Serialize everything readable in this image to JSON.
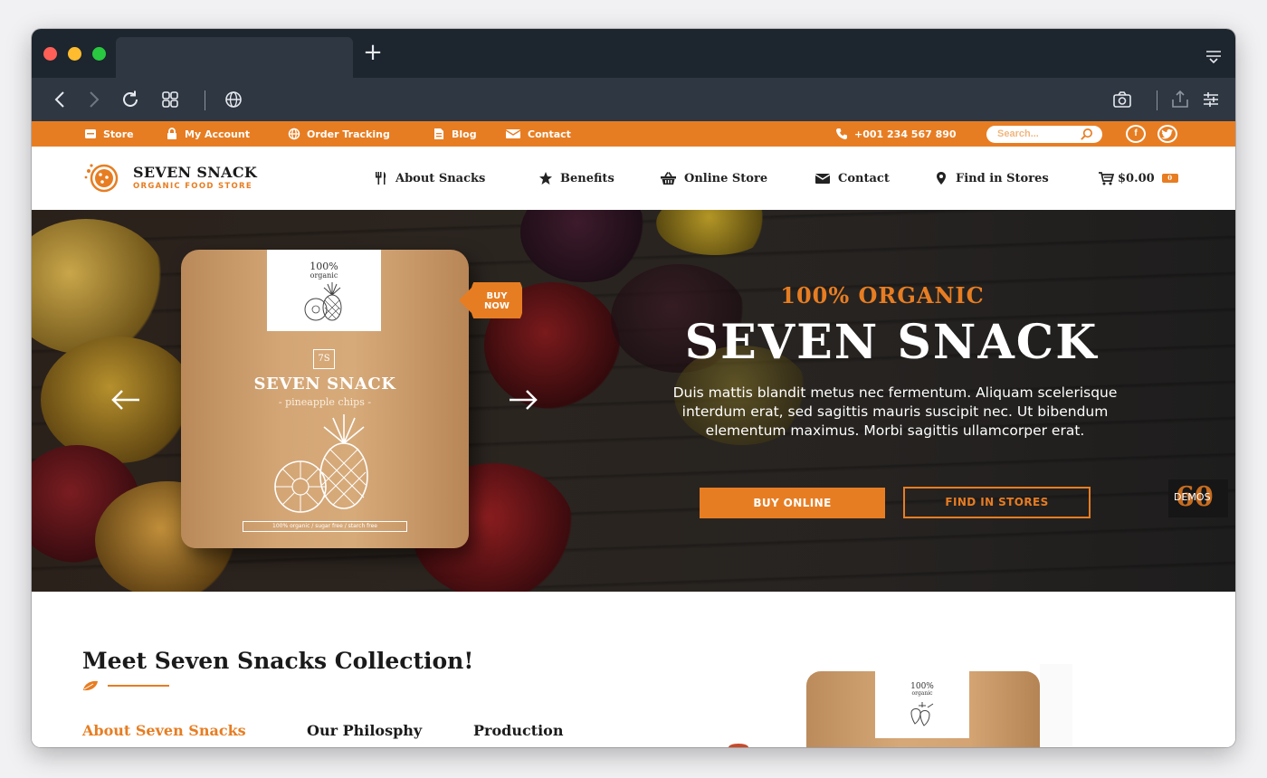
{
  "browser": {
    "new_tab_symbol": "+",
    "icons": [
      "back-icon",
      "forward-icon",
      "reload-icon",
      "tab-grid-icon",
      "globe-icon",
      "screenshot-icon",
      "share-icon",
      "settings-icon",
      "tab-menu-icon"
    ]
  },
  "topbar": {
    "links": [
      {
        "label": "Store",
        "icon": "store-icon"
      },
      {
        "label": "My Account",
        "icon": "lock-icon"
      },
      {
        "label": "Order Tracking",
        "icon": "globe-icon"
      },
      {
        "label": "Blog",
        "icon": "document-icon"
      },
      {
        "label": "Contact",
        "icon": "envelope-icon"
      }
    ],
    "phone": "+001 234 567 890",
    "search_placeholder": "Search...",
    "social": [
      "f",
      "t"
    ]
  },
  "header": {
    "brand": "SEVEN SNACK",
    "tagline": "ORGANIC FOOD STORE",
    "nav": [
      {
        "label": "About Snacks",
        "icon": "cutlery-icon"
      },
      {
        "label": "Benefits",
        "icon": "star-icon"
      },
      {
        "label": "Online Store",
        "icon": "basket-icon"
      },
      {
        "label": "Contact",
        "icon": "envelope-icon"
      },
      {
        "label": "Find in Stores",
        "icon": "map-pin-icon"
      }
    ],
    "cart_total": "$0.00",
    "cart_count": "0"
  },
  "hero": {
    "kicker": "100% ORGANIC",
    "title": "SEVEN SNACK",
    "text": "Duis mattis blandit metus nec fermentum. Aliquam scelerisque interdum erat, sed sagittis mauris suscipit nec. Ut bibendum elementum maximus. Morbi sagittis ullamcorper erat.",
    "buy_button": "BUY ONLINE",
    "find_button": "FIND IN STORES",
    "buy_now_badge": [
      "BUY",
      "NOW"
    ],
    "pouch": {
      "label_top": "100%",
      "label_bottom": "organic",
      "logo": "7S",
      "name": "SEVEN SNACK",
      "flavor": "- pineapple chips -",
      "footer": "100% organic / sugar free / starch free"
    },
    "demos_count": "60",
    "demos_label": "DEMOS"
  },
  "content": {
    "title": "Meet Seven Snacks Collection!",
    "tabs": [
      "About Seven Snacks",
      "Our Philosphy",
      "Production"
    ],
    "pouch_label_top": "100%",
    "pouch_label_bottom": "organic"
  },
  "colors": {
    "accent": "#e77d22",
    "chrome_dark": "#1d252e",
    "chrome_toolbar": "#2e3742"
  }
}
